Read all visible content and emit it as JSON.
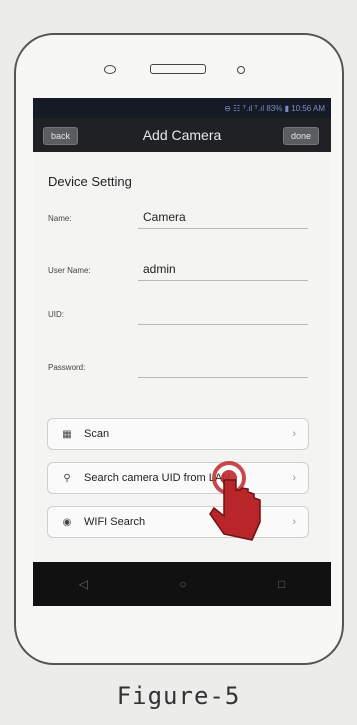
{
  "status_bar": {
    "text": "⊖ ☷ ᵀ.ıl ᵀ.ıl 83% ▮ 10:56 AM"
  },
  "header": {
    "back_label": "back",
    "title": "Add Camera",
    "done_label": "done"
  },
  "form": {
    "section_title": "Device Setting",
    "fields": [
      {
        "label": "Name:",
        "value": "Camera"
      },
      {
        "label": "User Name:",
        "value": "admin"
      },
      {
        "label": "UID:",
        "value": ""
      },
      {
        "label": "Password:",
        "value": ""
      }
    ]
  },
  "actions": [
    {
      "icon": "qr-scan-icon",
      "glyph": "▦",
      "label": "Scan"
    },
    {
      "icon": "search-key-icon",
      "glyph": "⚲",
      "label": "Search camera UID from LAN"
    },
    {
      "icon": "wifi-icon",
      "glyph": "◉",
      "label": "WIFI Search"
    }
  ],
  "nav": {
    "back_glyph": "◁",
    "home_glyph": "○",
    "recent_glyph": "□"
  },
  "caption": "Figure-5",
  "colors": {
    "accent_hand": "#c0282b",
    "title_bar": "#1f2124",
    "status_text": "#7e8cc8"
  }
}
